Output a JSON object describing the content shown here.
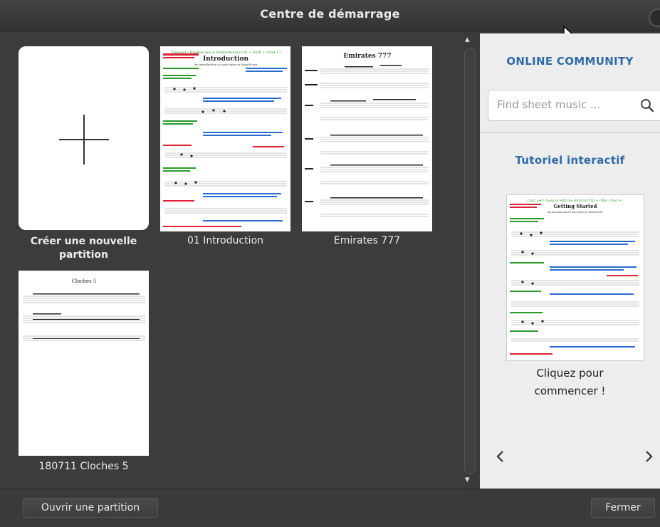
{
  "window": {
    "title": "Centre de démarrage"
  },
  "scores": {
    "new_score_label": "Créer une nouvelle partition",
    "items": [
      {
        "label": "01 Introduction",
        "page_heading": "Introduction"
      },
      {
        "label": "Emirates 777",
        "page_heading": "Emirates 777"
      },
      {
        "label": "180711 Cloches 5",
        "page_heading": "Cloches 5"
      }
    ]
  },
  "community": {
    "heading": "ONLINE COMMUNITY",
    "search_placeholder": "Find sheet music ...",
    "search_icon": "magnifier-icon"
  },
  "tutorial": {
    "heading": "Tutoriel interactif",
    "page_heading": "Getting Started",
    "caption": "Cliquez pour commencer !",
    "prev_icon": "chevron-left-icon",
    "next_icon": "chevron-right-icon"
  },
  "footer": {
    "open_label": "Ouvrir une partition",
    "close_label": "Fermer"
  },
  "colors": {
    "accent": "#2f6ba8",
    "panel_dark": "#3c3c3c",
    "panel_light": "#ededed"
  }
}
